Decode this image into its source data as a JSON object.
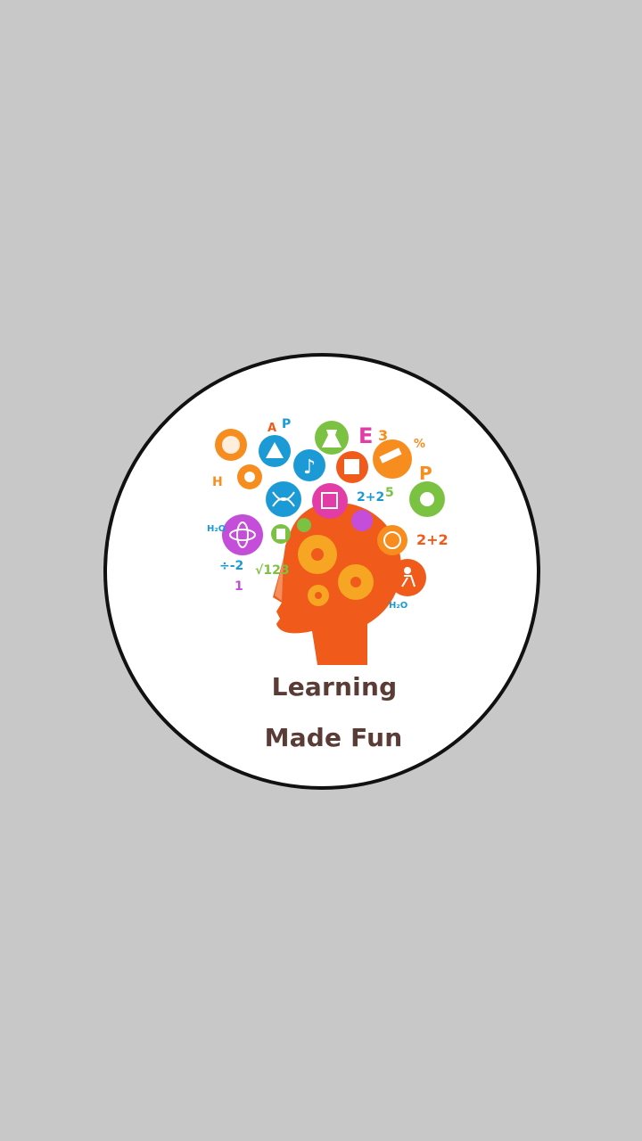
{
  "splash": {
    "logo_title_line1": "Learning",
    "logo_title_line2": "Made Fun"
  },
  "colors": {
    "background": "#c8c8c8",
    "circle_fill": "#ffffff",
    "circle_border": "#111111",
    "text": "#5a3b36",
    "head_orange": "#f05a1a",
    "gear": "#f6a623"
  },
  "icons": [
    "palette-icon",
    "ruler-icon",
    "flask-icon",
    "telescope-icon",
    "music-note-icon",
    "book-icon",
    "dna-icon",
    "cube-icon",
    "atom-icon",
    "globe-icon",
    "microscope-icon",
    "calculator-icon",
    "runner-icon",
    "gear-icon",
    "head-silhouette-icon"
  ]
}
